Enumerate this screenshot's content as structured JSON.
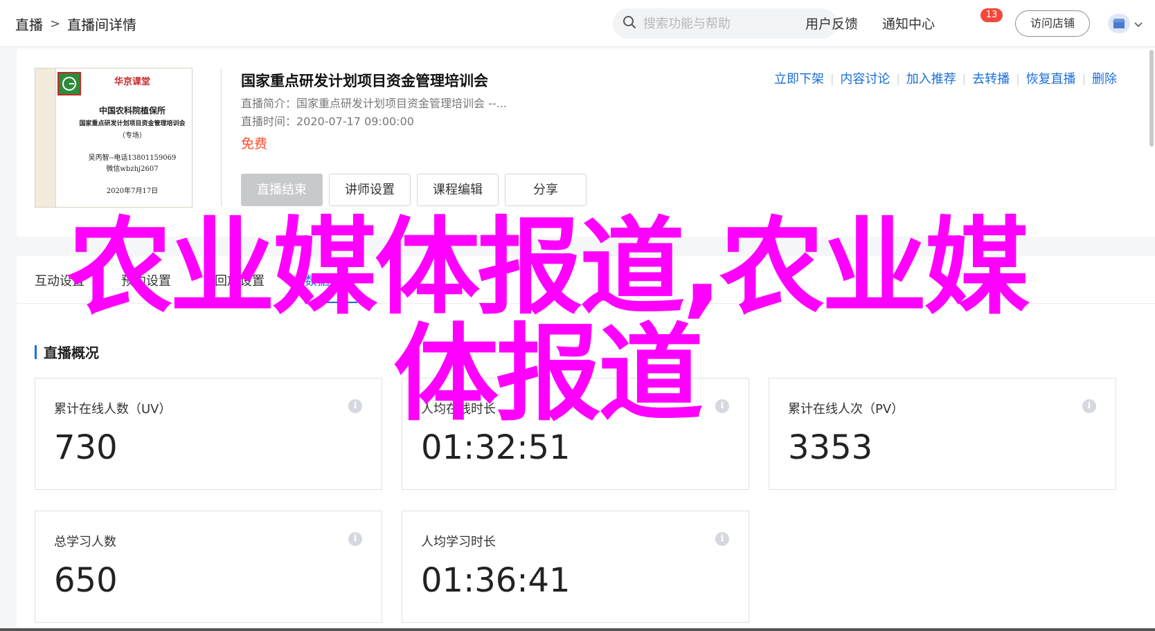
{
  "header": {
    "breadcrumb": [
      "直播",
      "直播间详情"
    ],
    "breadcrumb_sep": ">",
    "search_placeholder": "搜索功能与帮助",
    "feedback": "用户反馈",
    "notifications": "通知中心",
    "notification_count": "13",
    "visit_store": "访问店铺"
  },
  "course": {
    "title": "国家重点研发计划项目资金管理培训会",
    "desc": "直播简介：国家重点研发计划项目资金管理培训会 --...",
    "time": "直播时间：2020-07-17 09:00:00",
    "price": "免费",
    "thumbnail": {
      "brand": "华京课堂",
      "org": "中国农科院植保所",
      "line1": "国家重点研发计划项目资金管理培训会",
      "line2": "（专场）",
      "contact1": "吴丙智--电话13801159069",
      "contact2": "微信wbzhj2607",
      "date": "2020年7月17日"
    },
    "buttons": [
      "直播结束",
      "讲师设置",
      "课程编辑",
      "分享"
    ],
    "actions": [
      "立即下架",
      "内容讨论",
      "加入推荐",
      "去转播",
      "恢复直播",
      "删除"
    ]
  },
  "tabs": [
    "互动设置",
    "预约设置",
    "回放设置",
    "数据分析"
  ],
  "section_title": "直播概况",
  "stats": [
    {
      "label": "累计在线人数（UV）",
      "value": "730"
    },
    {
      "label": "人均在线时长",
      "value": "01:32:51"
    },
    {
      "label": "累计在线人次（PV）",
      "value": "3353"
    },
    {
      "label": "总学习人数",
      "value": "650"
    },
    {
      "label": "人均学习时长",
      "value": "01:36:41"
    }
  ],
  "watermark": "农业媒体报道,农业媒体报道",
  "colors": {
    "accent": "#1a6fd8",
    "price": "#ff4d2a",
    "watermark": "#ff00ff",
    "badge": "#f5483b"
  }
}
